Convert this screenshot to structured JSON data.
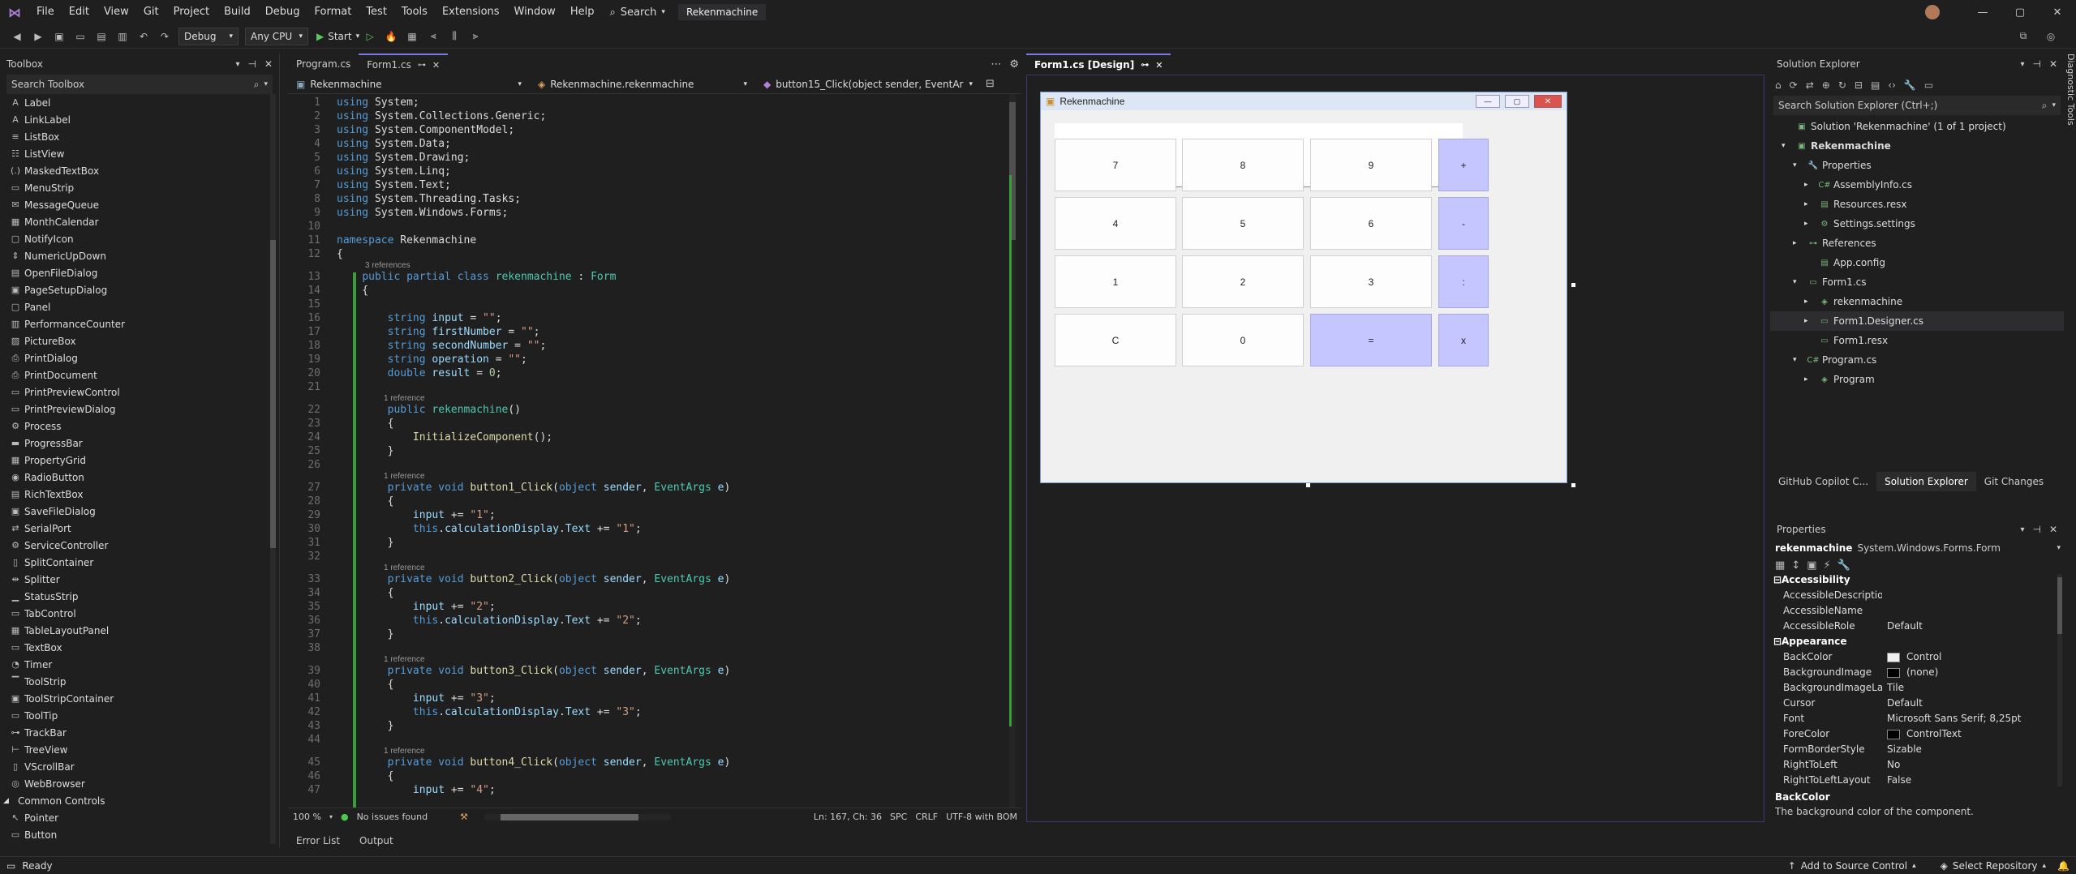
{
  "menubar": {
    "items": [
      "File",
      "Edit",
      "View",
      "Git",
      "Project",
      "Build",
      "Debug",
      "Format",
      "Test",
      "Tools",
      "Extensions",
      "Window",
      "Help"
    ],
    "search_label": "Search",
    "solution_name": "Rekenmachine"
  },
  "toolbar": {
    "config": "Debug",
    "platform": "Any CPU",
    "start_label": "Start"
  },
  "toolbox": {
    "title": "Toolbox",
    "search_placeholder": "Search Toolbox",
    "items": [
      {
        "icon": "A",
        "label": "Label"
      },
      {
        "icon": "A",
        "label": "LinkLabel"
      },
      {
        "icon": "≡",
        "label": "ListBox"
      },
      {
        "icon": "☷",
        "label": "ListView"
      },
      {
        "icon": "(.)",
        "label": "MaskedTextBox"
      },
      {
        "icon": "▭",
        "label": "MenuStrip"
      },
      {
        "icon": "✉",
        "label": "MessageQueue"
      },
      {
        "icon": "▦",
        "label": "MonthCalendar"
      },
      {
        "icon": "▢",
        "label": "NotifyIcon"
      },
      {
        "icon": "⇕",
        "label": "NumericUpDown"
      },
      {
        "icon": "▤",
        "label": "OpenFileDialog"
      },
      {
        "icon": "▣",
        "label": "PageSetupDialog"
      },
      {
        "icon": "▢",
        "label": "Panel"
      },
      {
        "icon": "▥",
        "label": "PerformanceCounter"
      },
      {
        "icon": "▨",
        "label": "PictureBox"
      },
      {
        "icon": "⎙",
        "label": "PrintDialog"
      },
      {
        "icon": "⎙",
        "label": "PrintDocument"
      },
      {
        "icon": "▭",
        "label": "PrintPreviewControl"
      },
      {
        "icon": "▭",
        "label": "PrintPreviewDialog"
      },
      {
        "icon": "⚙",
        "label": "Process"
      },
      {
        "icon": "▬",
        "label": "ProgressBar"
      },
      {
        "icon": "▦",
        "label": "PropertyGrid"
      },
      {
        "icon": "◉",
        "label": "RadioButton"
      },
      {
        "icon": "▤",
        "label": "RichTextBox"
      },
      {
        "icon": "▣",
        "label": "SaveFileDialog"
      },
      {
        "icon": "⇄",
        "label": "SerialPort"
      },
      {
        "icon": "⚙",
        "label": "ServiceController"
      },
      {
        "icon": "▯",
        "label": "SplitContainer"
      },
      {
        "icon": "⇹",
        "label": "Splitter"
      },
      {
        "icon": "▁",
        "label": "StatusStrip"
      },
      {
        "icon": "▭",
        "label": "TabControl"
      },
      {
        "icon": "▦",
        "label": "TableLayoutPanel"
      },
      {
        "icon": "▭",
        "label": "TextBox"
      },
      {
        "icon": "◔",
        "label": "Timer"
      },
      {
        "icon": "▔",
        "label": "ToolStrip"
      },
      {
        "icon": "▣",
        "label": "ToolStripContainer"
      },
      {
        "icon": "▭",
        "label": "ToolTip"
      },
      {
        "icon": "⊶",
        "label": "TrackBar"
      },
      {
        "icon": "⊢",
        "label": "TreeView"
      },
      {
        "icon": "▯",
        "label": "VScrollBar"
      },
      {
        "icon": "◎",
        "label": "WebBrowser"
      }
    ],
    "section_common": "Common Controls",
    "common_items": [
      {
        "icon": "↖",
        "label": "Pointer"
      },
      {
        "icon": "▭",
        "label": "Button"
      }
    ]
  },
  "editor": {
    "tabs": [
      {
        "label": "Program.cs"
      },
      {
        "label": "Form1.cs"
      }
    ],
    "nav_project": "Rekenmachine",
    "nav_class": "Rekenmachine.rekenmachine",
    "nav_member": "button15_Click(object sender, EventArgs e)",
    "zoom": "100 %",
    "issues": "No issues found",
    "position": "Ln: 167, Ch: 36",
    "spc": "SPC",
    "crlf": "CRLF",
    "encoding": "UTF-8 with BOM"
  },
  "code": {
    "ref3": "3 references",
    "ref1": "1 reference",
    "lines": {
      "l1": "using System;",
      "l2": "using System.Collections.Generic;",
      "l3": "using System.ComponentModel;",
      "l4": "using System.Data;",
      "l5": "using System.Drawing;",
      "l6": "using System.Linq;",
      "l7": "using System.Text;",
      "l8": "using System.Threading.Tasks;",
      "l9": "using System.Windows.Forms;"
    }
  },
  "designer": {
    "tab_label": "Form1.cs [Design]",
    "form_title": "Rekenmachine",
    "buttons": [
      "7",
      "8",
      "9",
      "+",
      "4",
      "5",
      "6",
      "-",
      "1",
      "2",
      "3",
      ":",
      "C",
      "0",
      "=",
      "x"
    ]
  },
  "solution": {
    "title": "Solution Explorer",
    "search_placeholder": "Search Solution Explorer (Ctrl+;)",
    "nodes": [
      {
        "label": "Solution 'Rekenmachine' (1 of 1 project)"
      },
      {
        "label": "Rekenmachine"
      },
      {
        "label": "Properties"
      },
      {
        "label": "AssemblyInfo.cs"
      },
      {
        "label": "Resources.resx"
      },
      {
        "label": "Settings.settings"
      },
      {
        "label": "References"
      },
      {
        "label": "App.config"
      },
      {
        "label": "Form1.cs"
      },
      {
        "label": "rekenmachine"
      },
      {
        "label": "Form1.Designer.cs"
      },
      {
        "label": "Form1.resx"
      },
      {
        "label": "Program.cs"
      },
      {
        "label": "Program"
      }
    ],
    "bottom_tabs": [
      "GitHub Copilot C...",
      "Solution Explorer",
      "Git Changes"
    ]
  },
  "properties": {
    "title": "Properties",
    "object_name": "rekenmachine",
    "object_type": "System.Windows.Forms.Form",
    "cat_accessibility": "Accessibility",
    "cat_appearance": "Appearance",
    "rows_access": [
      {
        "k": "AccessibleDescription",
        "v": ""
      },
      {
        "k": "AccessibleName",
        "v": ""
      },
      {
        "k": "AccessibleRole",
        "v": "Default"
      }
    ],
    "rows_appear": [
      {
        "k": "BackColor",
        "v": "Control"
      },
      {
        "k": "BackgroundImage",
        "v": "(none)"
      },
      {
        "k": "BackgroundImageLayout",
        "v": "Tile"
      },
      {
        "k": "Cursor",
        "v": "Default"
      },
      {
        "k": "Font",
        "v": "Microsoft Sans Serif; 8,25pt"
      },
      {
        "k": "ForeColor",
        "v": "ControlText"
      },
      {
        "k": "FormBorderStyle",
        "v": "Sizable"
      },
      {
        "k": "RightToLeft",
        "v": "No"
      },
      {
        "k": "RightToLeftLayout",
        "v": "False"
      }
    ],
    "desc_title": "BackColor",
    "desc_text": "The background color of the component."
  },
  "bottom_tabs": [
    "Error List",
    "Output"
  ],
  "status": {
    "ready": "Ready",
    "source_control": "Add to Source Control",
    "repo": "Select Repository"
  },
  "side_label": "Diagnostic Tools"
}
